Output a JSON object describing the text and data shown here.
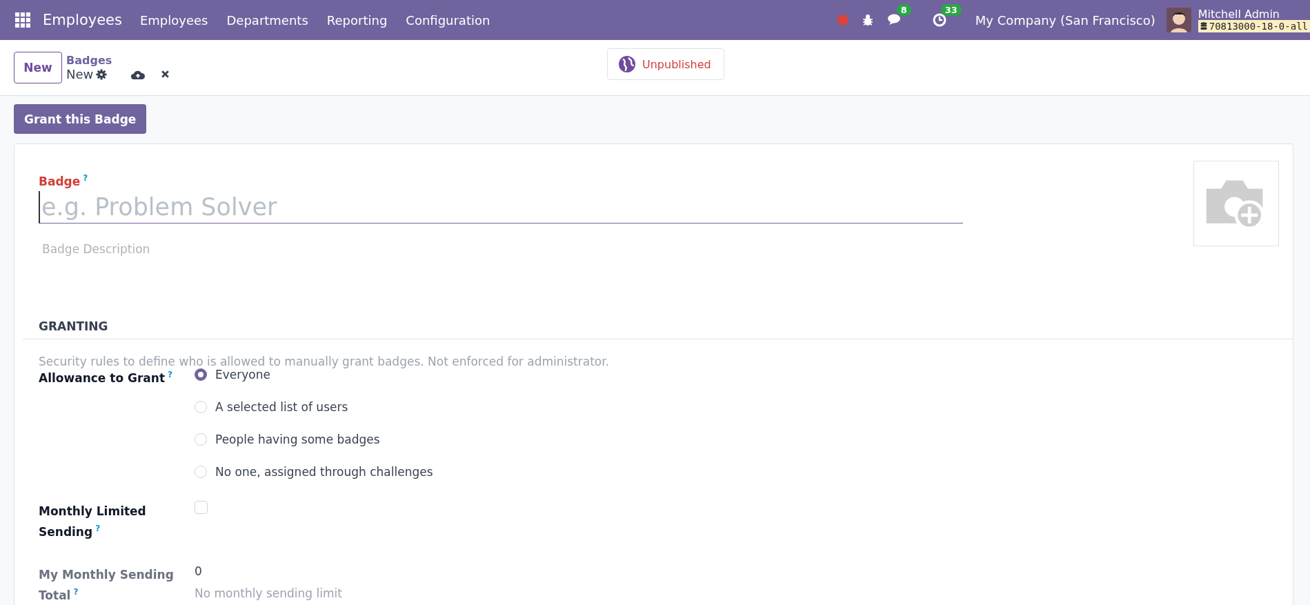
{
  "navbar": {
    "app_name": "Employees",
    "menu": [
      "Employees",
      "Departments",
      "Reporting",
      "Configuration"
    ],
    "messages_count": "8",
    "activities_count": "33",
    "company": "My Company (San Francisco)",
    "user_name": "Mitchell Admin",
    "database": "70813000-18-0-all"
  },
  "control_panel": {
    "new_button": "New",
    "breadcrumb": "Badges",
    "record_name": "New",
    "publish_status": "Unpublished"
  },
  "header_buttons": [
    "Grant this Badge"
  ],
  "form": {
    "badge_label": "Badge",
    "help_mark": "?",
    "badge_placeholder": "e.g. Problem Solver",
    "description_placeholder": "Badge Description",
    "granting": {
      "title": "GRANTING",
      "hint": "Security rules to define who is allowed to manually grant badges. Not enforced for administrator.",
      "allowance_label": "Allowance to Grant",
      "allowance_help": "?",
      "options": [
        {
          "label": "Everyone",
          "selected": true
        },
        {
          "label": "A selected list of users",
          "selected": false
        },
        {
          "label": "People having some badges",
          "selected": false
        },
        {
          "label": "No one, assigned through challenges",
          "selected": false
        }
      ],
      "monthly_label_lines": [
        "Monthly Limited",
        "Sending"
      ],
      "monthly_help": "?",
      "monthly_checked": false,
      "total_label_lines": [
        "My Monthly Sending",
        "Total"
      ],
      "total_help": "?",
      "total_value": "0",
      "total_note": "No monthly sending limit"
    }
  }
}
